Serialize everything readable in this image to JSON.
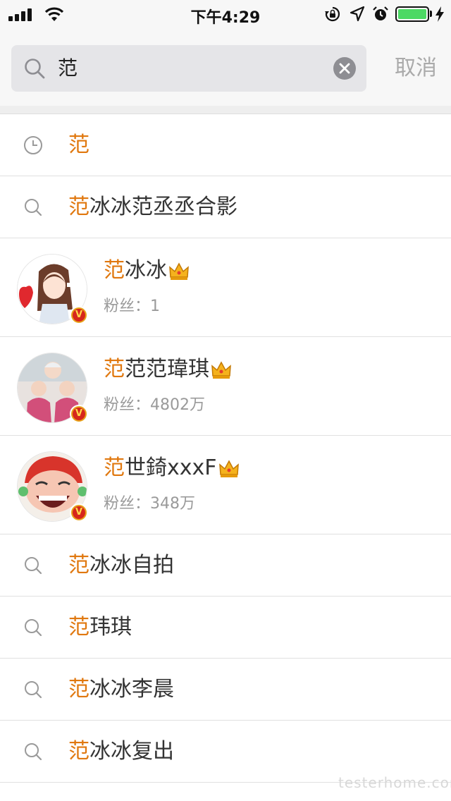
{
  "status_bar": {
    "time": "下午4:29",
    "battery_level": 1.0,
    "signal_icon": "signal-bars-icon",
    "wifi_icon": "wifi-icon"
  },
  "search": {
    "query": "范",
    "cancel_label": "取消"
  },
  "results": {
    "history": {
      "highlight": "范",
      "rest": ""
    },
    "suggestion_top": {
      "highlight": "范",
      "rest": "冰冰范丞丞合影"
    },
    "users": [
      {
        "name_highlight": "范",
        "name_rest": "冰冰",
        "fans_label": "粉丝：",
        "fans_value": "1"
      },
      {
        "name_highlight": "范",
        "name_rest": "范范瑋琪",
        "fans_label": "粉丝：",
        "fans_value": "4802万"
      },
      {
        "name_highlight": "范",
        "name_rest": "世錡xxxF",
        "fans_label": "粉丝：",
        "fans_value": "348万"
      }
    ],
    "suggestions": [
      {
        "highlight": "范",
        "rest": "冰冰自拍"
      },
      {
        "highlight": "范",
        "rest": "玮琪"
      },
      {
        "highlight": "范",
        "rest": "冰冰李晨"
      },
      {
        "highlight": "范",
        "rest": "冰冰复出"
      }
    ]
  },
  "badge": {
    "verified_letter": "V"
  },
  "colors": {
    "highlight": "#e0780f",
    "battery": "#4cd964",
    "badge_red": "#d6261c",
    "badge_gold": "#e8a31a"
  },
  "watermark": "testerhome.com"
}
